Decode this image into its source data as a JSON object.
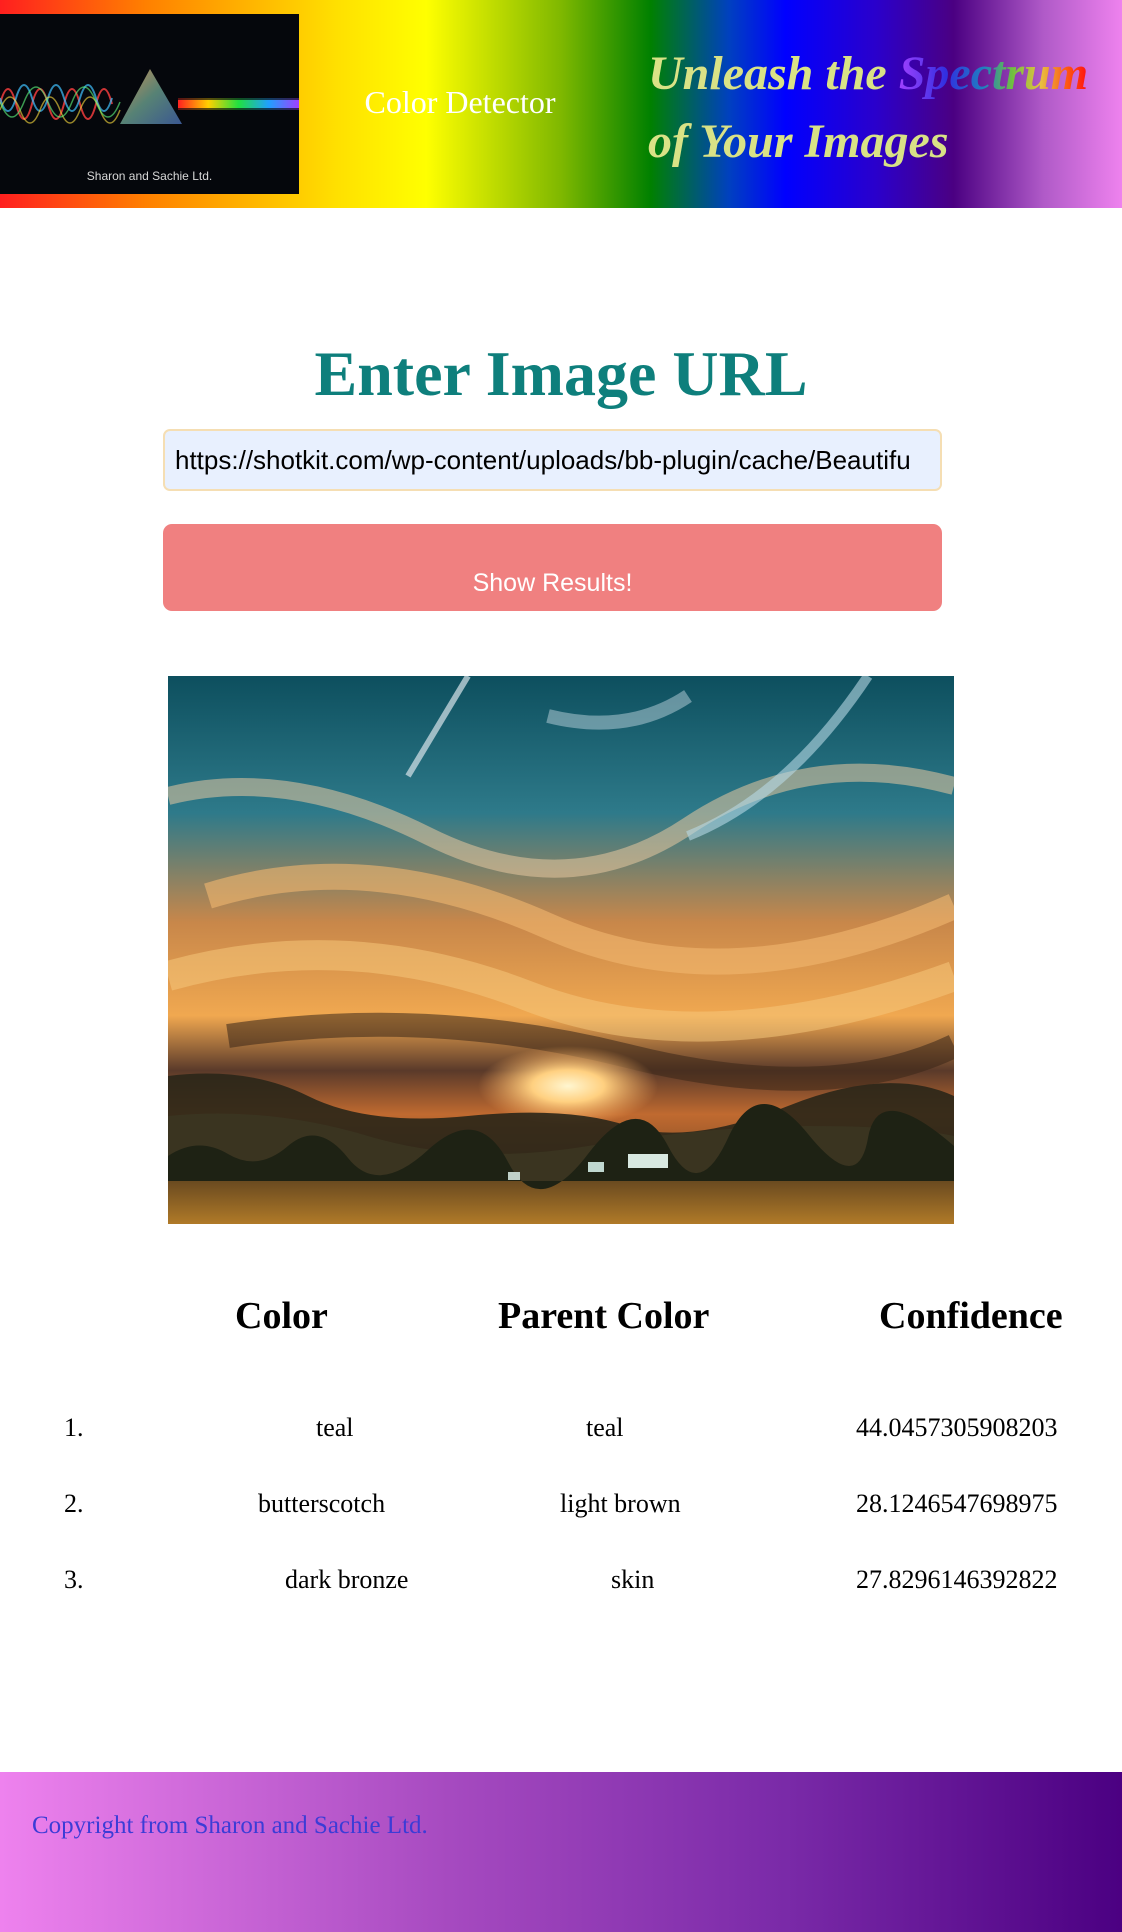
{
  "header": {
    "logo_caption": "Sharon and Sachie Ltd.",
    "app_title": "Color Detector",
    "tagline_part1": "Unleash the ",
    "tagline_highlight": "Spectrum",
    "tagline_part2": "of Your Images"
  },
  "form": {
    "heading": "Enter Image URL",
    "url_value": "https://shotkit.com/wp-content/uploads/bb-plugin/cache/Beautifu",
    "submit_label": "Show Results!"
  },
  "results": {
    "headers": {
      "color": "Color",
      "parent": "Parent Color",
      "confidence": "Confidence"
    },
    "rows": [
      {
        "index": "1.",
        "color": "teal",
        "parent": "teal",
        "confidence": "44.0457305908203"
      },
      {
        "index": "2.",
        "color": "butterscotch",
        "parent": "light brown",
        "confidence": "28.1246547698975"
      },
      {
        "index": "3.",
        "color": "dark bronze",
        "parent": "skin",
        "confidence": "27.8296146392822"
      }
    ]
  },
  "footer": {
    "copyright": "Copyright from Sharon and Sachie Ltd."
  },
  "colors": {
    "heading_teal": "#0e7f7c",
    "button": "#f08080",
    "tagline": "#d9e286",
    "copyright": "#3c3cd6"
  }
}
